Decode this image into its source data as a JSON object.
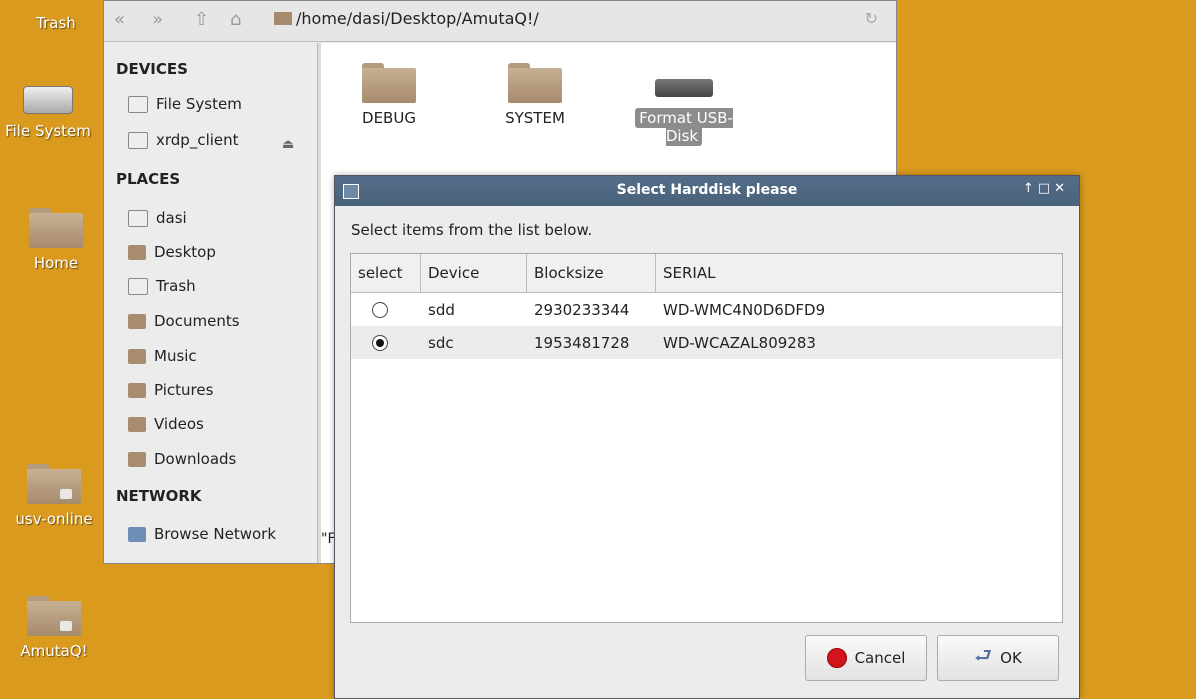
{
  "desktop": {
    "icons": [
      {
        "label": "Trash"
      },
      {
        "label": "File System"
      },
      {
        "label": "Home"
      },
      {
        "label": "usv-online"
      },
      {
        "label": "AmutaQ!"
      }
    ]
  },
  "file_manager": {
    "path": "/home/dasi/Desktop/AmutaQ!/",
    "sidebar": {
      "devices_header": "DEVICES",
      "devices": [
        {
          "label": "File System"
        },
        {
          "label": "xrdp_client"
        }
      ],
      "places_header": "PLACES",
      "places": [
        {
          "label": "dasi"
        },
        {
          "label": "Desktop"
        },
        {
          "label": "Trash"
        },
        {
          "label": "Documents"
        },
        {
          "label": "Music"
        },
        {
          "label": "Pictures"
        },
        {
          "label": "Videos"
        },
        {
          "label": "Downloads"
        }
      ],
      "network_header": "NETWORK",
      "network": [
        {
          "label": "Browse Network"
        }
      ]
    },
    "files": [
      {
        "label": "DEBUG"
      },
      {
        "label": "SYSTEM"
      },
      {
        "label": "Format USB-Disk"
      }
    ],
    "status_text": "\"F"
  },
  "dialog": {
    "title": "Select Harddisk please",
    "prompt": "Select items from the list below.",
    "columns": [
      "select",
      "Device",
      "Blocksize",
      "SERIAL"
    ],
    "rows": [
      {
        "selected": false,
        "device": "sdd",
        "blocksize": "2930233344",
        "serial": "WD-WMC4N0D6DFD9"
      },
      {
        "selected": true,
        "device": "sdc",
        "blocksize": "1953481728",
        "serial": "WD-WCAZAL809283"
      }
    ],
    "cancel_label": "Cancel",
    "ok_label": "OK"
  }
}
